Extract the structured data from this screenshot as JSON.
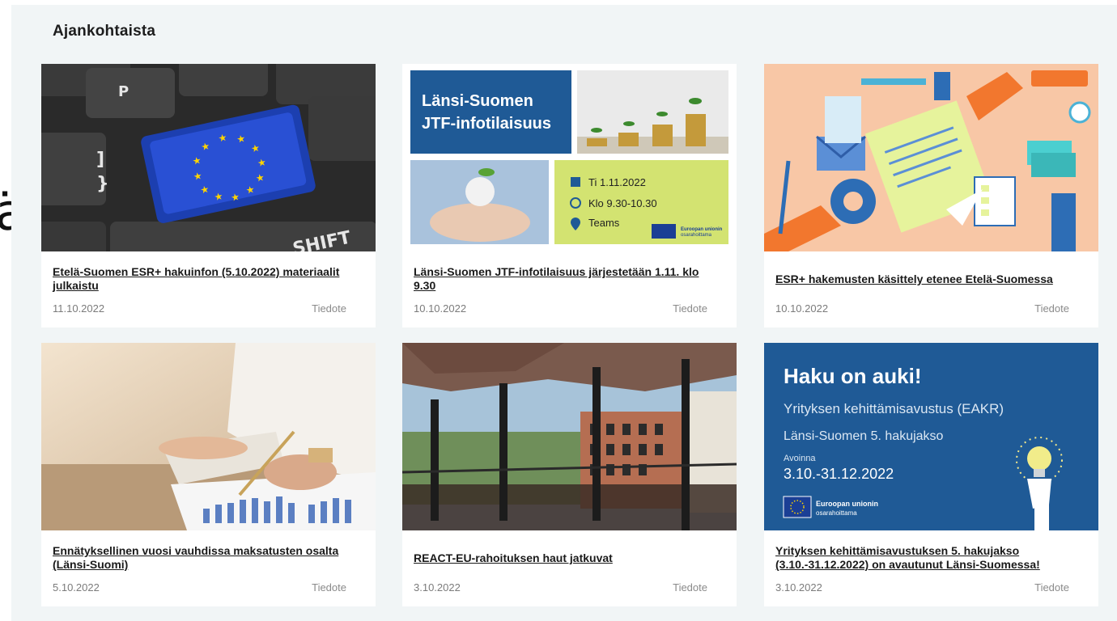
{
  "stray_glyph": "ä",
  "section": {
    "title": "Ajankohtaista"
  },
  "cards": [
    {
      "title": "Etelä-Suomen ESR+ hakuinfon (5.10.2022) materiaalit julkaistu",
      "date": "11.10.2022",
      "type": "Tiedote",
      "image": {
        "keys": [
          "P",
          "]",
          "}",
          "SHIFT"
        ]
      }
    },
    {
      "title": "Länsi-Suomen JTF-infotilaisuus järjestetään 1.11. klo 9.30",
      "date": "10.10.2022",
      "type": "Tiedote",
      "image": {
        "heading_line1": "Länsi-Suomen",
        "heading_line2": "JTF-infotilaisuus",
        "date_line": "Ti 1.11.2022",
        "time_line": "Klo 9.30-10.30",
        "place_line": "Teams",
        "eu_line1": "Euroopan unionin",
        "eu_line2": "osarahoittama"
      }
    },
    {
      "title": "ESR+ hakemusten käsittely etenee Etelä-Suomessa",
      "date": "10.10.2022",
      "type": "Tiedote",
      "image": {}
    },
    {
      "title": "Ennätyksellinen vuosi vauhdissa maksatusten osalta (Länsi-Suomi)",
      "date": "5.10.2022",
      "type": "Tiedote",
      "image": {}
    },
    {
      "title": "REACT-EU-rahoituksen haut jatkuvat",
      "date": "3.10.2022",
      "type": "Tiedote",
      "image": {}
    },
    {
      "title": "Yrityksen kehittämisavustuksen 5. hakujakso (3.10.-31.12.2022) on avautunut Länsi-Suomessa!",
      "date": "3.10.2022",
      "type": "Tiedote",
      "image": {
        "heading": "Haku on auki!",
        "line1": "Yrityksen kehittämisavustus (EAKR)",
        "line2": "Länsi-Suomen 5. hakujakso",
        "open_label": "Avoinna",
        "open_dates": "3.10.-31.12.2022",
        "eu_line1": "Euroopan unionin",
        "eu_line2": "osarahoittama"
      }
    }
  ],
  "colors": {
    "panel_bg": "#f1f5f6",
    "jtf_blue": "#1f5a96",
    "jtf_green": "#d3e371",
    "haku_blue": "#1f5a96",
    "eu_blue": "#1b3f95",
    "eu_star": "#ffd400",
    "illustration_bg": "#f8c7a6"
  }
}
